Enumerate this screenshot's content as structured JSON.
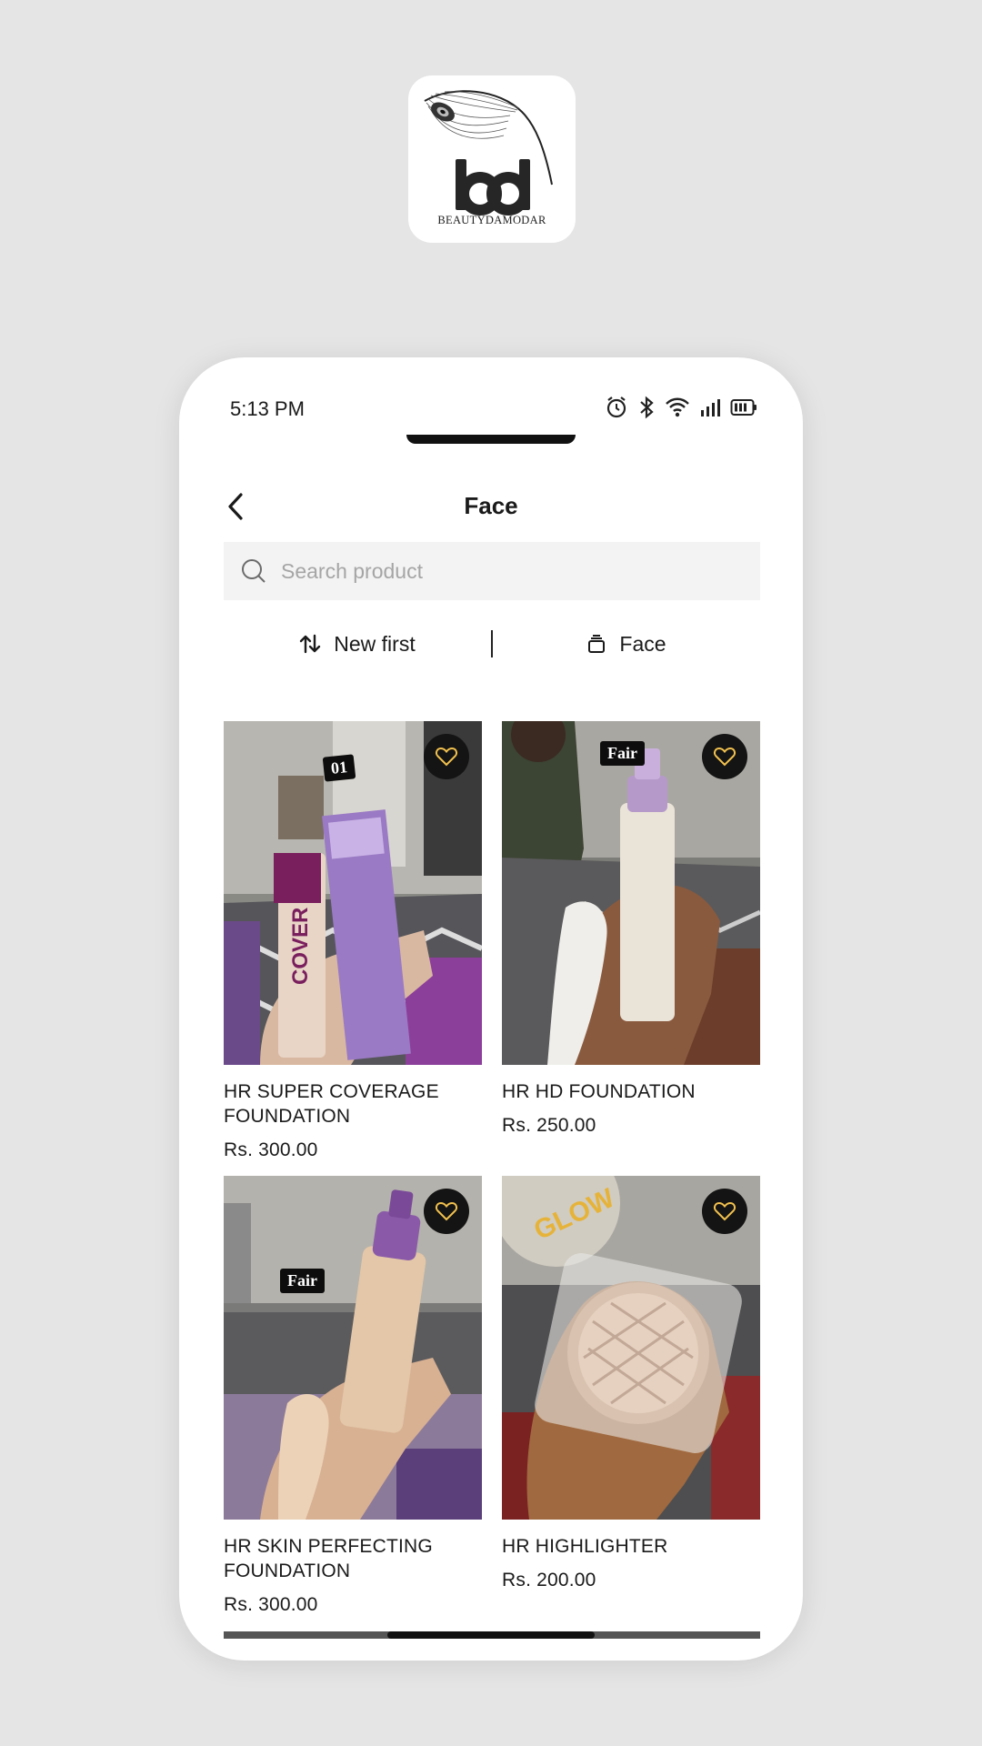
{
  "app_logo": {
    "monogram": "bd",
    "brand_name": "BEAUTYDAMODAR"
  },
  "status_bar": {
    "time": "5:13 PM",
    "icons": [
      "alarm-icon",
      "bluetooth-icon",
      "wifi-icon",
      "signal-icon",
      "battery-icon"
    ]
  },
  "header": {
    "title": "Face",
    "back_icon": "chevron-left-icon"
  },
  "search": {
    "placeholder": "Search product",
    "value": ""
  },
  "filters": {
    "sort_label": "New first",
    "category_label": "Face"
  },
  "products": [
    {
      "name": "HR SUPER COVERAGE FOUNDATION",
      "price": "Rs. 300.00",
      "badge": "01"
    },
    {
      "name": "HR HD FOUNDATION",
      "price": "Rs. 250.00",
      "badge": "Fair"
    },
    {
      "name": "HR SKIN PERFECTING FOUNDATION",
      "price": "Rs. 300.00",
      "badge": "Fair"
    },
    {
      "name": "HR HIGHLIGHTER",
      "price": "Rs. 200.00",
      "badge": ""
    }
  ],
  "colors": {
    "page_background": "#e5e5e5",
    "surface": "#ffffff",
    "search_background": "#f3f3f3",
    "favorite_button": "#141414",
    "favorite_heart": "#f2c14e"
  }
}
